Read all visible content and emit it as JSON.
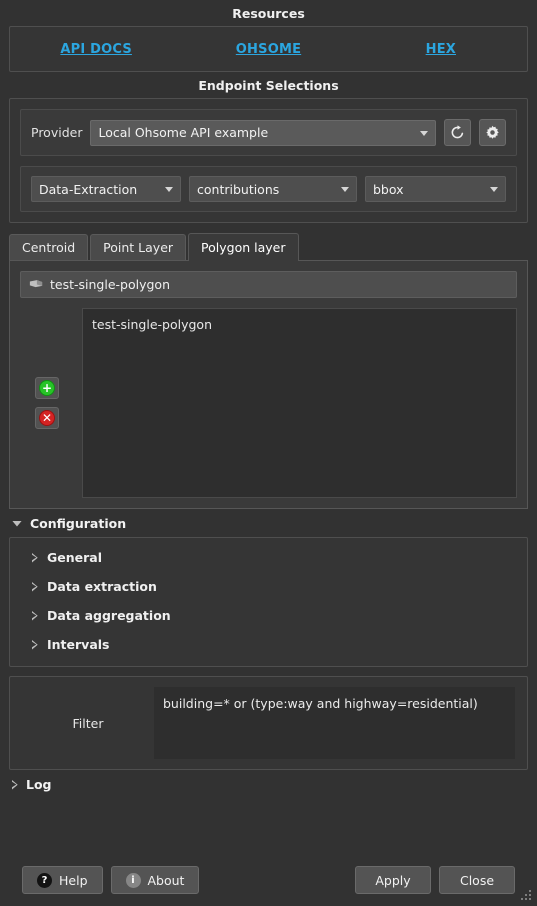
{
  "resources": {
    "title": "Resources",
    "links": [
      {
        "label": "API DOCS",
        "name": "api-docs-link"
      },
      {
        "label": "OHSOME",
        "name": "ohsome-link"
      },
      {
        "label": "HEX",
        "name": "hex-link"
      }
    ],
    "link_color": "#2ba6e0"
  },
  "endpoint": {
    "title": "Endpoint Selections",
    "provider_label": "Provider",
    "provider_value": "Local Ohsome API example",
    "refresh_icon": "refresh-icon",
    "settings_icon": "gear-icon",
    "selector1": "Data-Extraction",
    "selector2": "contributions",
    "selector3": "bbox"
  },
  "tabs": [
    {
      "label": "Centroid",
      "active": false
    },
    {
      "label": "Point Layer",
      "active": false
    },
    {
      "label": "Polygon layer",
      "active": true
    }
  ],
  "layer": {
    "selected": "test-single-polygon",
    "icon": "polygon-layer-icon",
    "add_label": "+",
    "remove_label": "✕",
    "items": [
      "test-single-polygon"
    ]
  },
  "configuration": {
    "title": "Configuration",
    "expanded": true,
    "sections": [
      {
        "label": "General",
        "expanded": false
      },
      {
        "label": "Data extraction",
        "expanded": false
      },
      {
        "label": "Data aggregation",
        "expanded": false
      },
      {
        "label": "Intervals",
        "expanded": false
      }
    ]
  },
  "filter": {
    "label": "Filter",
    "value": "building=* or (type:way and highway=residential)"
  },
  "log": {
    "label": "Log",
    "expanded": false
  },
  "buttons": {
    "help": "Help",
    "about": "About",
    "apply": "Apply",
    "close": "Close",
    "help_icon": "question-mark-icon",
    "about_icon": "info-icon"
  }
}
